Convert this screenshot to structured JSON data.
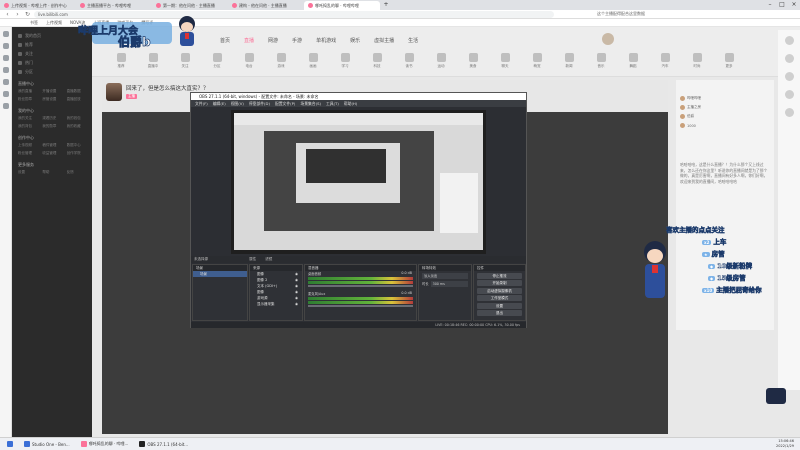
{
  "browser": {
    "tabs": [
      {
        "label": "上传视频 - 哔哩上传 · 创作中心",
        "active": false
      },
      {
        "label": "主播直播平台 - 哔哩哔哩",
        "active": false
      },
      {
        "label": "第一期：他在问他 · 主播直播",
        "active": false
      },
      {
        "label": "建构 - 他在问他 · 主播直播",
        "active": false
      },
      {
        "label": "哪吒捣乱的聊 · 哔哩哔哩",
        "active": true
      }
    ],
    "url": "live.bilibili.com",
    "search_hint": "这个主播配得配合这里数据",
    "bookmarks": [
      "书签",
      "上传视频",
      "NOVA流",
      "上班直播",
      "游戏平台",
      "撰写评"
    ]
  },
  "overlay": {
    "banner_line1": "哔哩上月大会",
    "banner_line2": "伯爵b",
    "promo_title": "喜欢主播的点点关注",
    "promo_items": [
      {
        "prefix": "x2",
        "text": "上车"
      },
      {
        "prefix": "",
        "text": "房管"
      },
      {
        "prefix": "",
        "text": "10级新粉牌"
      },
      {
        "prefix": "",
        "text": "15级房管"
      },
      {
        "prefix": "x10",
        "text": "主播把屁寄给你"
      }
    ]
  },
  "live": {
    "nav": [
      "首页",
      "直播",
      "网游",
      "手游",
      "单机游戏",
      "娱乐",
      "虚拟主播",
      "生活"
    ],
    "categories": [
      "推荐",
      "直播中",
      "关注",
      "分区",
      "电台",
      "游戏",
      "画画",
      "学习",
      "科技",
      "读书",
      "运动",
      "美食",
      "聊天",
      "萌宠",
      "新闻",
      "音乐",
      "舞蹈",
      "汽车",
      "时尚",
      "更多"
    ],
    "room_title": "回来了，但是怎么搞这大直实？？",
    "room_tag": "主播",
    "chat_users": [
      "哔哩哔哩",
      "主播之房",
      "伯爵",
      "1000"
    ],
    "chat_message": "哈哈哈哈，这是什么直播？！为什么那个又上线过来，怎么还在你这里？听说你的直播间就是为了那个做的，真是厉害啊，直播间有好多人啊，你们好啊，欢迎来到我的直播间，哈哈哈哈哈"
  },
  "sidebar": {
    "top_items": [
      "我的首页",
      "推荐",
      "关注",
      "热门",
      "分区"
    ],
    "sections": [
      {
        "title": "直播中心",
        "items": [
          "我的直播",
          "开播设置",
          "直播数据",
          "粉丝勋章",
          "房管设置",
          "直播回放"
        ]
      },
      {
        "title": "我的中心",
        "items": [
          "我的关注",
          "观看历史",
          "我的钱包",
          "我的背包",
          "我的勋章",
          "我的收藏"
        ]
      },
      {
        "title": "创作中心",
        "items": [
          "上传视频",
          "稿件管理",
          "数据中心",
          "粉丝管理",
          "收益管理",
          "创作学院"
        ]
      },
      {
        "title": "更多服务",
        "items": [
          "设置",
          "帮助",
          "反馈"
        ]
      }
    ]
  },
  "obs": {
    "title": "OBS 27.1.1 (64-bit, windows) - 配置文件: 未命名 - 场景: 未命名",
    "menu": [
      "文件(F)",
      "编辑(E)",
      "视图(V)",
      "停靠部件(D)",
      "配置文件(P)",
      "场景集合(S)",
      "工具(T)",
      "帮助(H)"
    ],
    "no_source": "未选择源",
    "properties_label": "属性",
    "filters_label": "滤镜",
    "docks": {
      "scenes": "场景",
      "sources": "来源",
      "mixer": "混音器",
      "transitions": "转场特效",
      "controls": "控件"
    },
    "scene_items": [
      "场景"
    ],
    "source_items": [
      "图像",
      "图像 2",
      "文本 (GDI+)",
      "图像",
      "游戏源",
      "显示器采集"
    ],
    "mixer_tracks": [
      {
        "name": "桌面音频",
        "level": "0.0 dB"
      },
      {
        "name": "麦克风/Aux",
        "level": "0.0 dB"
      }
    ],
    "transition": {
      "type": "淡入淡出",
      "duration_label": "时长",
      "duration": "300 ms"
    },
    "controls": [
      "停止推流",
      "开始录制",
      "启动虚拟摄像机",
      "工作室模式",
      "设置",
      "退出"
    ],
    "status": "LIVE: 00:18:46   REC: 00:00:00   CPU: 6.1%, 30.00 fps"
  },
  "taskbar": {
    "items": [
      {
        "label": "Studio One - Ben...",
        "color": "#3b6fd6"
      },
      {
        "label": "哪吒捣乱的聊 · 哔哩...",
        "color": "#fb7299"
      },
      {
        "label": "OBS 27.1.1 (64-bit...",
        "color": "#222222"
      }
    ],
    "time": "15:06:46",
    "date": "2022/1/29"
  }
}
